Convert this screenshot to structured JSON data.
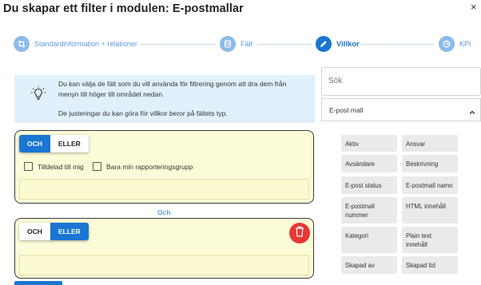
{
  "window": {
    "title": "Du skapar ett filter i modulen: E-postmallar",
    "close_label": "×"
  },
  "stepper": {
    "steps": [
      {
        "label": "Standardinformation + relationer",
        "icon": "crop-icon",
        "active": false
      },
      {
        "label": "Fält",
        "icon": "database-icon",
        "active": false
      },
      {
        "label": "Villkor",
        "icon": "pencil-icon",
        "active": true
      },
      {
        "label": "KPI",
        "icon": "pie-chart-icon",
        "active": false
      }
    ]
  },
  "info": {
    "line1": "Du kan välja de fält som du vill använda för filtrering genom att dra dem från menyn till höger till området nedan.",
    "line2": "De justeringar du kan göra för villkor beror på fältets typ."
  },
  "groups": [
    {
      "and_label": "OCH",
      "or_label": "ELLER",
      "selected": "and",
      "checkboxes": [
        {
          "label": "Tilldelad till mig",
          "checked": false
        },
        {
          "label": "Bara min rapporteringsgrupp",
          "checked": false
        }
      ]
    },
    {
      "and_label": "OCH",
      "or_label": "ELLER",
      "selected": "or",
      "has_delete": true
    }
  ],
  "connector_label": "Och",
  "sidebar": {
    "search_placeholder": "Sök",
    "section_label": "E-post mall",
    "fields": [
      "Aktiv",
      "Ansvar",
      "Avsändare",
      "Beskrivning",
      "E-post status",
      "E-postmall namn",
      "E-postmall nummer",
      "HTML innehåll",
      "Kategori",
      "Plain text innehåll",
      "Skapad av",
      "Skapad tid"
    ]
  },
  "colors": {
    "primary": "#1976d2",
    "step_inactive": "#8dbbe8",
    "info_bg": "#e1f0fb",
    "card_bg": "#fcfbd7",
    "delete": "#e53935",
    "field_bg": "#e8eaeb"
  }
}
